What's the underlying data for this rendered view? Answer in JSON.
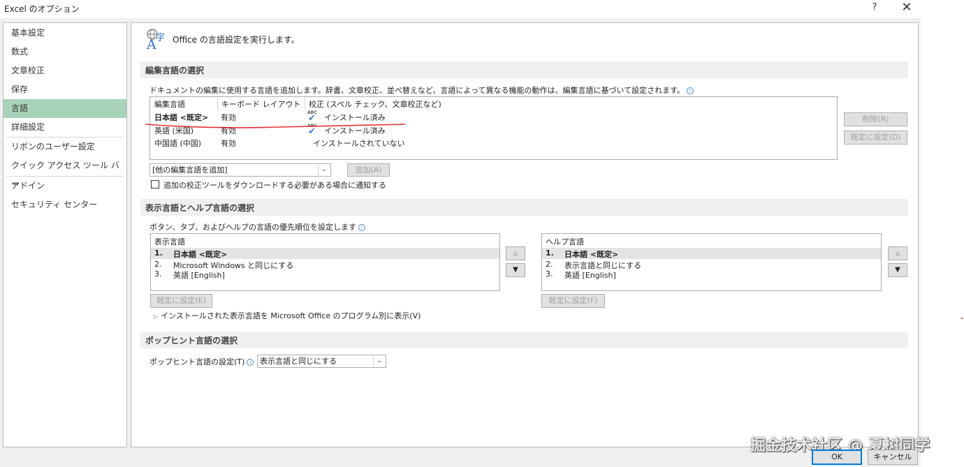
{
  "window": {
    "title": "Excel のオプション",
    "help": "?",
    "close": "✕"
  },
  "sidebar": {
    "items": [
      {
        "label": "基本設定"
      },
      {
        "label": "数式"
      },
      {
        "label": "文章校正"
      },
      {
        "label": "保存"
      },
      {
        "label": "言語",
        "active": true
      },
      {
        "label": "詳細設定"
      },
      {
        "label": "リボンのユーザー設定"
      },
      {
        "label": "クイック アクセス ツール バー"
      },
      {
        "label": "アドイン"
      },
      {
        "label": "セキュリティ センター"
      }
    ]
  },
  "header": {
    "icon": "language-icon",
    "intro": "Office の言語設定を実行します。"
  },
  "editing": {
    "section_title": "編集言語の選択",
    "description": "ドキュメントの編集に使用する言語を追加します。辞書、文章校正、並べ替えなど、言語によって異なる機能の動作は、編集言語に基づいて設定されます。",
    "columns": [
      "編集言語",
      "キーボード レイアウト",
      "校正 (スペル チェック、文章校正など)"
    ],
    "rows": [
      {
        "language": "日本語 <既定>",
        "keyboard": "有効",
        "proofing": "インストール済み",
        "proofing_icon": "abc-check-icon",
        "bold": true
      },
      {
        "language": "英語 (米国)",
        "keyboard": "有効",
        "proofing": "インストール済み",
        "proofing_icon": "abc-check-icon"
      },
      {
        "language": "中国語 (中国)",
        "keyboard": "有効",
        "proofing": "インストールされていない"
      }
    ],
    "remove_button": "削除(R)",
    "set_default_button": "既定に設定(D)",
    "add_dropdown": "[他の編集言語を追加]",
    "add_button": "追加(A)",
    "notify_checkbox": "追加の校正ツールをダウンロードする必要がある場合に通知する",
    "notify_checked": false
  },
  "display": {
    "section_title": "表示言語とヘルプ言語の選択",
    "description": "ボタン、タブ、およびヘルプの言語の優先順位を設定します",
    "display_list": {
      "header": "表示言語",
      "items": [
        {
          "num": "1.",
          "label": "日本語 <既定>"
        },
        {
          "num": "2.",
          "label": "Microsoft Windows と同じにする"
        },
        {
          "num": "3.",
          "label": "英語 [English]"
        }
      ],
      "set_default_button": "既定に設定(E)"
    },
    "help_list": {
      "header": "ヘルプ言語",
      "items": [
        {
          "num": "1.",
          "label": "日本語 <既定>"
        },
        {
          "num": "2.",
          "label": "表示言語と同じにする"
        },
        {
          "num": "3.",
          "label": "英語 [English]"
        }
      ],
      "set_default_button": "既定に設定(F)"
    },
    "up_arrow": "▲",
    "down_arrow": "▼",
    "expander": "インストールされた表示言語を Microsoft Office のプログラム別に表示(V)"
  },
  "screentip": {
    "section_title": "ポップヒント言語の選択",
    "label": "ポップヒント言語の設定(T)",
    "value": "表示言語と同じにする"
  },
  "footer": {
    "ok": "OK",
    "cancel": "キャンセル"
  },
  "watermark": "掘金技术社区 @ 夏树同学",
  "colors": {
    "active_nav": "#a9d3b9",
    "annotation_red": "#e53030",
    "check_blue": "#3b7bd4",
    "ok_border": "#0078d7"
  }
}
